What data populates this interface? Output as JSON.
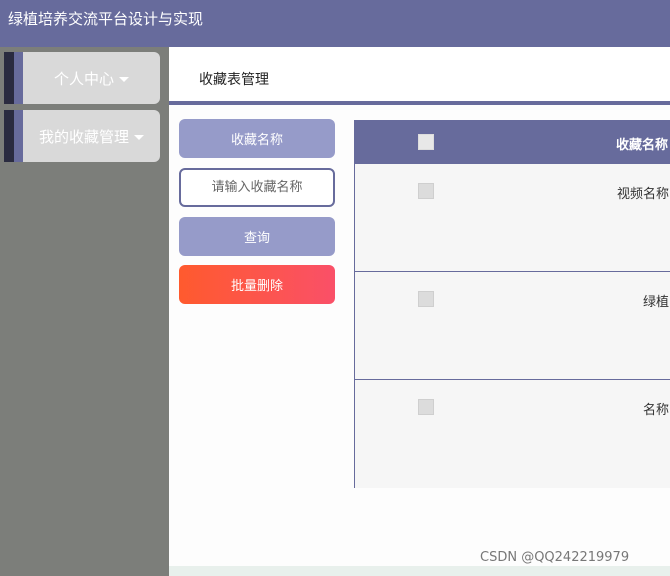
{
  "app": {
    "title": "绿植培养交流平台设计与实现"
  },
  "sidebar": {
    "items": [
      {
        "label": "个人中心"
      },
      {
        "label": "我的收藏管理"
      }
    ]
  },
  "page": {
    "title": "收藏表管理"
  },
  "filters": {
    "field_label": "收藏名称",
    "search_placeholder": "请输入收藏名称",
    "query_label": "查询",
    "batch_delete_label": "批量删除"
  },
  "table": {
    "columns": [
      "收藏名称"
    ],
    "rows": [
      {
        "name": "视频名称"
      },
      {
        "name": "绿植"
      },
      {
        "name": "名称"
      }
    ]
  },
  "watermark": "CSDN @QQ242219979",
  "colors": {
    "primary": "#676b9c",
    "light_primary": "#969bc9",
    "danger_start": "#ff5a2e",
    "danger_end": "#fa5068"
  }
}
